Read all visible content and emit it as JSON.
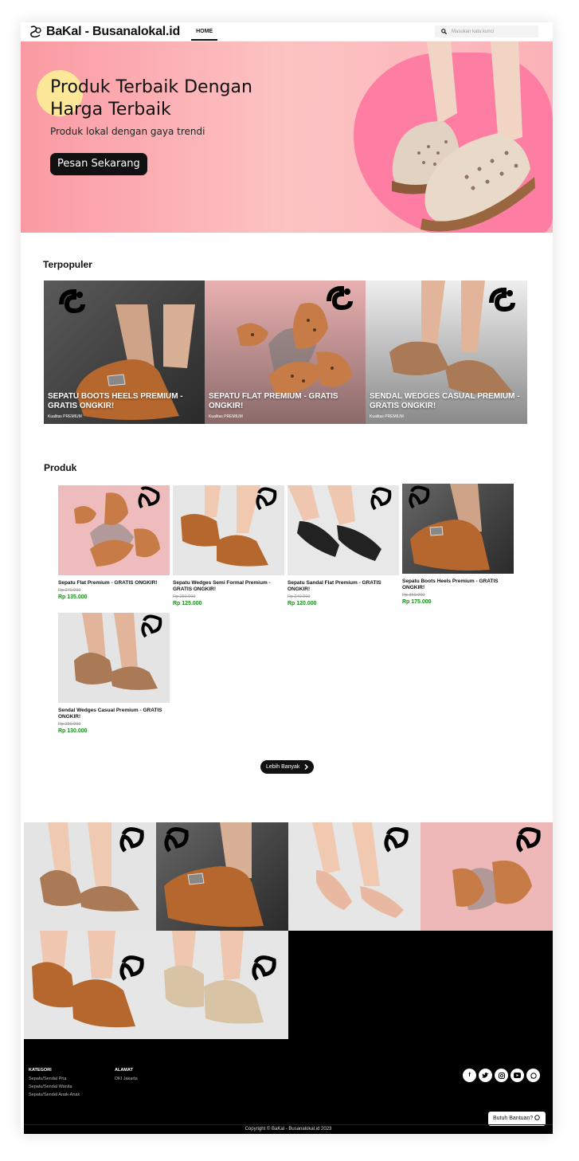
{
  "header": {
    "brand": "BaKal - Busanalokal.id",
    "nav_home": "HOME",
    "search_placeholder": "Masukan kata kunci"
  },
  "hero": {
    "title": "Produk Terbaik Dengan Harga Terbaik",
    "subtitle": "Produk lokal dengan gaya trendi",
    "cta": "Pesan Sekarang"
  },
  "popular": {
    "title": "Terpopuler",
    "items": [
      {
        "name": "SEPATU BOOTS HEELS PREMIUM - GRATIS ONGKIR!",
        "quality": "Kualitas PREMIUM"
      },
      {
        "name": "SEPATU FLAT PREMIUM - GRATIS ONGKIR!",
        "quality": "Kualitas PREMIUM"
      },
      {
        "name": "SENDAL WEDGES CASUAL PREMIUM - GRATIS ONGKIR!",
        "quality": "Kualitas PREMIUM"
      }
    ]
  },
  "products": {
    "title": "Produk",
    "items": [
      {
        "name": "Sepatu Flat Premium - GRATIS ONGKIR!",
        "old_price": "Rp 270.000",
        "price": "Rp 135.000"
      },
      {
        "name": "Sepatu Wedges Semi Formal Premium - GRATIS ONGKIR!",
        "old_price": "Rp 250.000",
        "price": "Rp 125.000"
      },
      {
        "name": "Sepatu Sandal Flat Premium - GRATIS ONGKIR!",
        "old_price": "Rp 240.000",
        "price": "Rp 120.000"
      },
      {
        "name": "Sepatu Boots Heels Premium - GRATIS ONGKIR!",
        "old_price": "Rp 350.000",
        "price": "Rp 175.000"
      },
      {
        "name": "Sendal Wedges Casual Premium - GRATIS ONGKIR!",
        "old_price": "Rp 260.000",
        "price": "Rp 130.000"
      }
    ],
    "more": "Lebih Banyak"
  },
  "footer": {
    "kategori_title": "KATEGORI",
    "kategori": [
      "Sepatu/Sendal Pria",
      "Sepatu/Sendal Wanita",
      "Sepatu/Sendal Anak-Anak"
    ],
    "alamat_title": "ALAMAT",
    "alamat": "DKI Jakarta",
    "socials": [
      "facebook-icon",
      "twitter-icon",
      "instagram-icon",
      "youtube-icon",
      "whatsapp-icon"
    ],
    "copyright": "Copyright © BaKal - Busanalokal.id 2023",
    "help": "Butuh Bantuan?"
  }
}
